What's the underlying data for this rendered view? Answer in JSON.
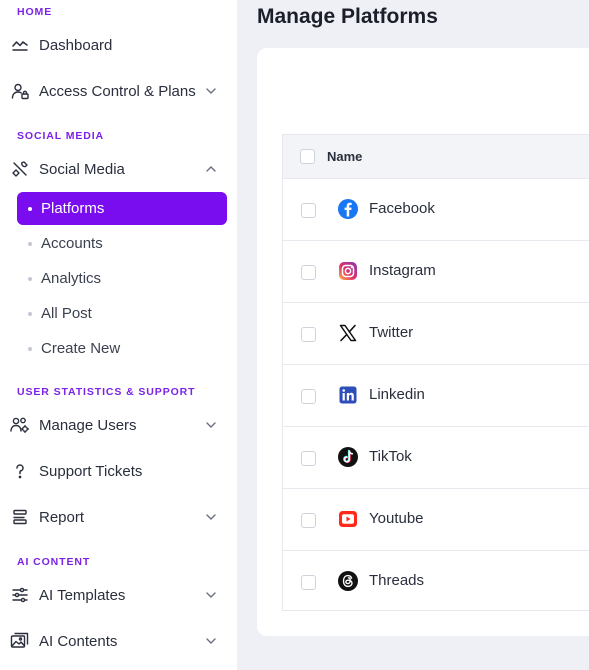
{
  "sidebar": {
    "sections": {
      "home": "HOME",
      "social": "SOCIAL MEDIA",
      "users": "USER STATISTICS & SUPPORT",
      "ai": "AI CONTENT"
    },
    "items": {
      "dashboard": "Dashboard",
      "access": "Access Control & Plans",
      "social_media": "Social Media",
      "manage_users": "Manage Users",
      "support": "Support Tickets",
      "report": "Report",
      "ai_templates": "AI Templates",
      "ai_contents": "AI Contents"
    },
    "social_sub": {
      "platforms": "Platforms",
      "accounts": "Accounts",
      "analytics": "Analytics",
      "all_post": "All Post",
      "create_new": "Create New"
    },
    "accent": "#7a0cf0"
  },
  "main": {
    "title": "Manage Platforms",
    "table": {
      "header_name": "Name",
      "rows": [
        {
          "name": "Facebook",
          "icon": "facebook-icon"
        },
        {
          "name": "Instagram",
          "icon": "instagram-icon"
        },
        {
          "name": "Twitter",
          "icon": "x-twitter-icon"
        },
        {
          "name": "Linkedin",
          "icon": "linkedin-icon"
        },
        {
          "name": "TikTok",
          "icon": "tiktok-icon"
        },
        {
          "name": "Youtube",
          "icon": "youtube-icon"
        },
        {
          "name": "Threads",
          "icon": "threads-icon"
        }
      ]
    }
  }
}
